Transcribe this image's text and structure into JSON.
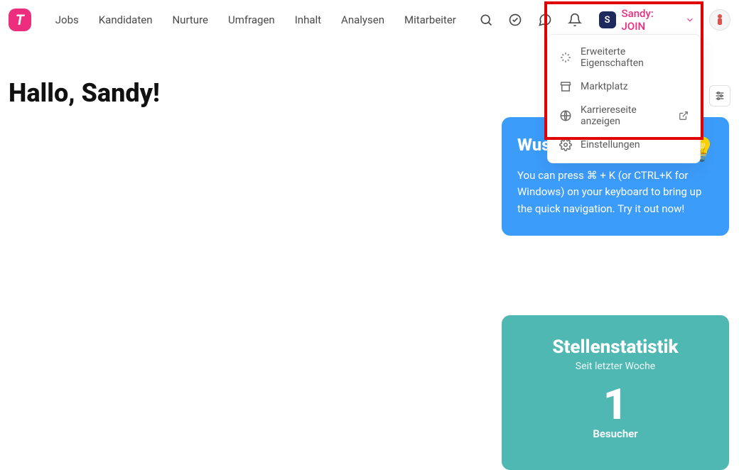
{
  "logo_letter": "T",
  "nav": [
    "Jobs",
    "Kandidaten",
    "Nurture",
    "Umfragen",
    "Inhalt",
    "Analysen",
    "Mitarbeiter"
  ],
  "user": {
    "initial": "S",
    "label": "Sandy: JOIN"
  },
  "dropdown": {
    "items": [
      "Erweiterte Eigenschaften",
      "Marktplatz",
      "Karriereseite anzeigen",
      "Einstellungen"
    ]
  },
  "greeting": "Hallo, Sandy!",
  "tip_card": {
    "title": "Wussten Sie, dass...",
    "body": "You can press ⌘ + K (or CTRL+K for Windows) on your keyboard to bring up the quick navigation. Try it out now!"
  },
  "stats_card": {
    "title": "Stellenstatistik",
    "subtitle": "Seit letzter Woche",
    "value": "1",
    "metric": "Besucher"
  }
}
